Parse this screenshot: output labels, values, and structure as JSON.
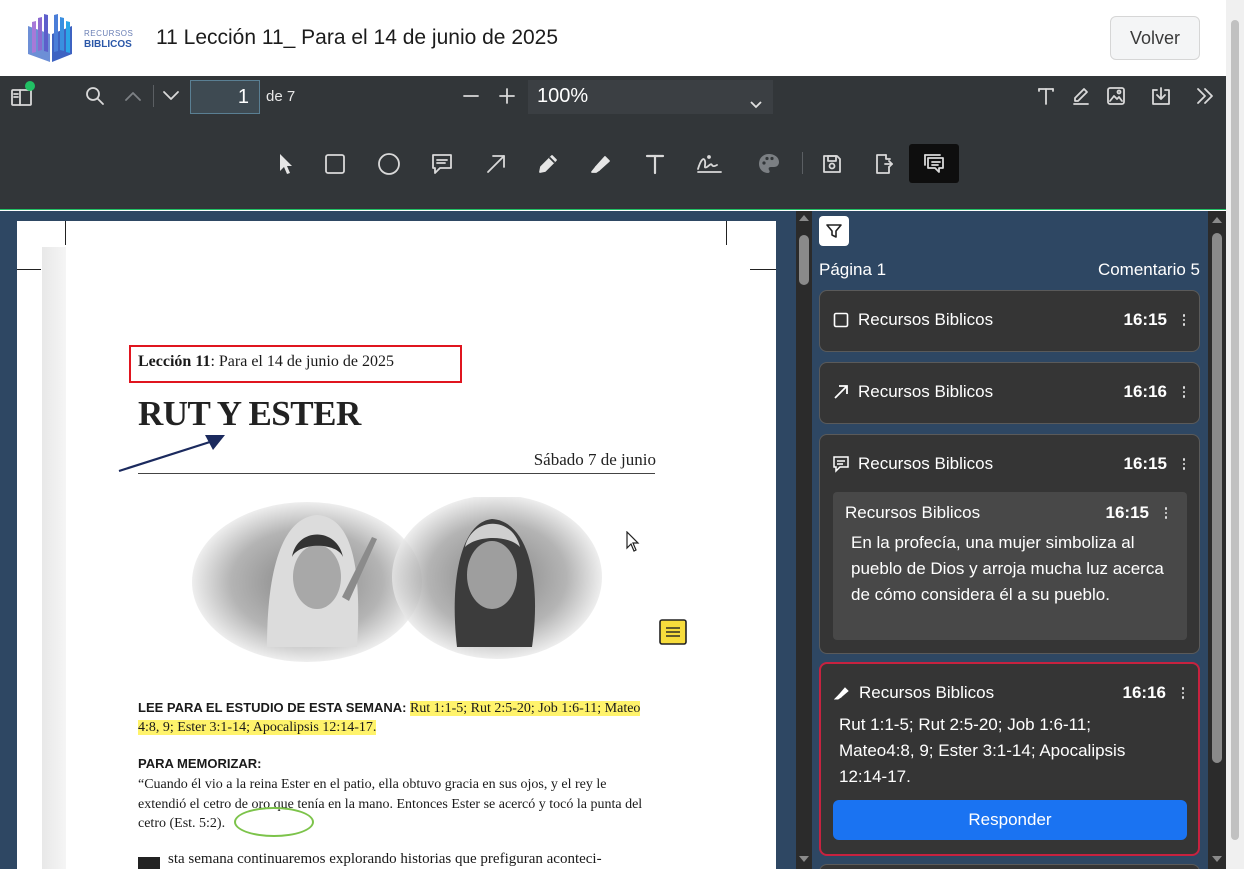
{
  "header": {
    "logo_line1": "RECURSOS",
    "logo_line2": "BIBLICOS",
    "title": "11 Lección 11_ Para el 14 de junio de 2025",
    "back_label": "Volver"
  },
  "toolbar": {
    "page_current": "1",
    "page_of": "de 7",
    "zoom": "100%",
    "icons_top_left": [
      "sidebar-toggle-icon",
      "search-icon",
      "chevron-up-icon",
      "chevron-down-icon"
    ],
    "icons_top_right": [
      "text-icon",
      "edit-icon",
      "image-icon",
      "download-icon",
      "double-chevron-right-icon"
    ],
    "annotation_tools": [
      "select-pointer-icon",
      "rectangle-icon",
      "ellipse-icon",
      "comment-icon",
      "arrow-icon",
      "pencil-icon",
      "highlighter-icon",
      "text-tool-icon",
      "signature-icon",
      "palette-icon",
      "save-icon",
      "export-icon",
      "comments-panel-icon"
    ],
    "accent": "#21c064"
  },
  "document": {
    "lesson_label": "Lección 11",
    "lesson_rest": ": Para el 14 de junio de 2025",
    "big_title": "RUT Y ESTER",
    "date": "Sábado 7 de junio",
    "lee_label": "LEE PARA EL ESTUDIO DE ESTA SEMANA:",
    "lee_refs": "Rut 1:1-5; Rut 2:5-20; Job 1:6-11; Mateo 4:8, 9; Ester 3:1-14; Apocalipsis 12:14-17.",
    "memo_label": "PARA MEMORIZAR:",
    "memo_text": "“Cuando él vio a la reina Ester en el patio, ella obtuvo gracia en sus ojos, y el rey le extendió el cetro de oro que tenía en la mano. Entonces Ester se acercó y tocó la punta del cetro",
    "memo_ref": "(Est. 5:2).",
    "body_start": "sta semana continuaremos explorando historias que prefiguran aconteci-"
  },
  "comments": {
    "page_label": "Página 1",
    "count_label": "Comentario 5",
    "cards": [
      {
        "icon": "rectangle-icon",
        "author": "Recursos Biblicos",
        "time": "16:15"
      },
      {
        "icon": "arrow-icon",
        "author": "Recursos Biblicos",
        "time": "16:16"
      },
      {
        "icon": "comment-icon",
        "author": "Recursos Biblicos",
        "time": "16:15",
        "reply": {
          "author": "Recursos Biblicos",
          "time": "16:15",
          "text": "En la profecía, una mujer simboliza al pueblo de Dios y arroja mucha luz acerca de cómo considera él a su pueblo."
        }
      },
      {
        "icon": "highlighter-icon",
        "author": "Recursos Biblicos",
        "time": "16:16",
        "text": "Rut 1:1-5; Rut 2:5-20; Job 1:6-11; Mateo4:8, 9; Ester 3:1-14; Apocalipsis 12:14-17.",
        "respond_label": "Responder",
        "selected": true
      }
    ],
    "colors": {
      "panel_bg": "#2e4763",
      "card_bg": "#353535",
      "selected_border": "#c7223f",
      "button": "#1a73f2"
    }
  }
}
